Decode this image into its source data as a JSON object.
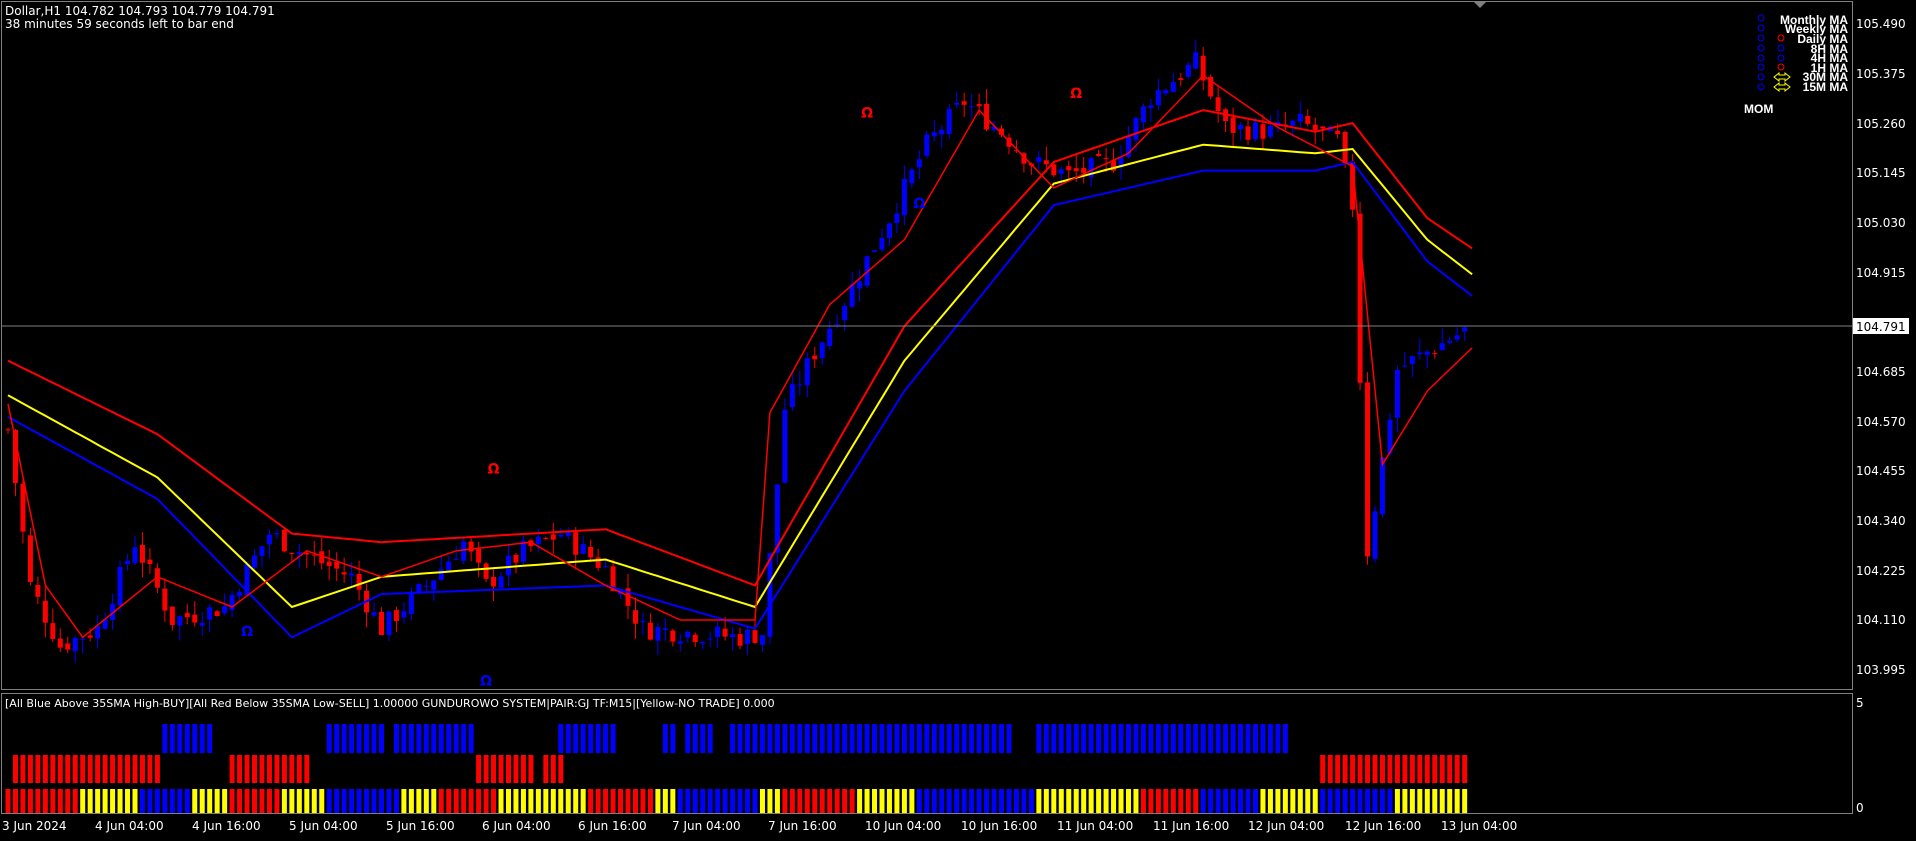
{
  "header": {
    "symbol_line": "Dollar,H1  104.782 104.793 104.779 104.791",
    "timer_line": "38 minutes 59 seconds left to bar end"
  },
  "price_axis": {
    "labels": [
      "105.490",
      "105.375",
      "105.260",
      "105.145",
      "105.030",
      "104.915",
      "104.685",
      "104.570",
      "104.455",
      "104.340",
      "104.225",
      "104.110",
      "103.995"
    ],
    "current_price": "104.791"
  },
  "time_axis": {
    "labels": [
      "3 Jun 2024",
      "4 Jun 04:00",
      "4 Jun 16:00",
      "5 Jun 04:00",
      "5 Jun 16:00",
      "6 Jun 04:00",
      "6 Jun 16:00",
      "7 Jun 04:00",
      "7 Jun 16:00",
      "10 Jun 04:00",
      "10 Jun 16:00",
      "11 Jun 04:00",
      "11 Jun 16:00",
      "12 Jun 04:00",
      "12 Jun 16:00",
      "13 Jun 04:00"
    ]
  },
  "legend": {
    "items": [
      "Monthly MA",
      "Weekly MA",
      "Daily MA",
      "8H MA",
      "4H MA",
      "1H MA",
      "30M MA",
      "15M MA"
    ],
    "mom_label": "MOM"
  },
  "indicator": {
    "title": "[All Blue Above 35SMA High-BUY][All Red Below 35SMA Low-SELL] 1.00000  GUNDUROWO SYSTEM|PAIR:GJ TF:M15|[Yellow-NO TRADE] 0.000",
    "scale_top": "5",
    "scale_bottom": "0"
  },
  "colors": {
    "background": "#000000",
    "bull": "#0000FF",
    "bear": "#FF0000",
    "ma_mid": "#FFFF00",
    "text": "#FFFFFF",
    "price_line": "#808080"
  },
  "chart_data": {
    "type": "candlestick",
    "symbol": "Dollar",
    "timeframe": "H1",
    "ylim": [
      103.95,
      105.56
    ],
    "current_price": 104.791,
    "close_path": [
      [
        0,
        104.56
      ],
      [
        3,
        104.2
      ],
      [
        7,
        104.06
      ],
      [
        12,
        104.1
      ],
      [
        17,
        104.3
      ],
      [
        22,
        104.12
      ],
      [
        29,
        104.15
      ],
      [
        35,
        104.32
      ],
      [
        40,
        104.27
      ],
      [
        46,
        104.22
      ],
      [
        50,
        104.1
      ],
      [
        56,
        104.2
      ],
      [
        61,
        104.3
      ],
      [
        64,
        104.2
      ],
      [
        69,
        104.28
      ],
      [
        74,
        104.32
      ],
      [
        80,
        104.24
      ],
      [
        85,
        104.1
      ],
      [
        92,
        104.09
      ],
      [
        98,
        104.08
      ],
      [
        101,
        104.09
      ],
      [
        104,
        104.61
      ],
      [
        108,
        104.74
      ],
      [
        113,
        104.89
      ],
      [
        118,
        105.05
      ],
      [
        123,
        105.22
      ],
      [
        128,
        105.32
      ],
      [
        133,
        105.25
      ],
      [
        137,
        105.18
      ],
      [
        142,
        105.15
      ],
      [
        148,
        105.18
      ],
      [
        153,
        105.33
      ],
      [
        159,
        105.41
      ],
      [
        163,
        105.26
      ],
      [
        169,
        105.25
      ],
      [
        173,
        105.27
      ],
      [
        178,
        105.23
      ],
      [
        180,
        105.08
      ],
      [
        182,
        104.28
      ],
      [
        186,
        104.7
      ],
      [
        190,
        104.74
      ],
      [
        195,
        104.79
      ]
    ],
    "ma_upper_path": [
      [
        0,
        104.72
      ],
      [
        20,
        104.55
      ],
      [
        38,
        104.32
      ],
      [
        50,
        104.3
      ],
      [
        80,
        104.33
      ],
      [
        100,
        104.2
      ],
      [
        120,
        104.8
      ],
      [
        140,
        105.18
      ],
      [
        160,
        105.3
      ],
      [
        175,
        105.25
      ],
      [
        180,
        105.27
      ],
      [
        190,
        105.05
      ],
      [
        196,
        104.98
      ]
    ],
    "ma_mid_path": [
      [
        0,
        104.64
      ],
      [
        20,
        104.45
      ],
      [
        38,
        104.15
      ],
      [
        50,
        104.22
      ],
      [
        80,
        104.26
      ],
      [
        100,
        104.15
      ],
      [
        120,
        104.72
      ],
      [
        140,
        105.13
      ],
      [
        160,
        105.22
      ],
      [
        175,
        105.2
      ],
      [
        180,
        105.21
      ],
      [
        190,
        105.0
      ],
      [
        196,
        104.92
      ]
    ],
    "ma_lower_path": [
      [
        0,
        104.59
      ],
      [
        20,
        104.4
      ],
      [
        38,
        104.08
      ],
      [
        50,
        104.18
      ],
      [
        80,
        104.2
      ],
      [
        100,
        104.1
      ],
      [
        120,
        104.65
      ],
      [
        140,
        105.08
      ],
      [
        160,
        105.16
      ],
      [
        175,
        105.16
      ],
      [
        180,
        105.18
      ],
      [
        190,
        104.95
      ],
      [
        196,
        104.87
      ]
    ],
    "fast_ma_path": [
      [
        0,
        104.62
      ],
      [
        5,
        104.2
      ],
      [
        10,
        104.08
      ],
      [
        20,
        104.22
      ],
      [
        30,
        104.15
      ],
      [
        40,
        104.28
      ],
      [
        50,
        104.22
      ],
      [
        60,
        104.28
      ],
      [
        70,
        104.3
      ],
      [
        80,
        104.2
      ],
      [
        90,
        104.12
      ],
      [
        100,
        104.12
      ],
      [
        102,
        104.6
      ],
      [
        110,
        104.85
      ],
      [
        120,
        105.0
      ],
      [
        130,
        105.3
      ],
      [
        140,
        105.12
      ],
      [
        150,
        105.2
      ],
      [
        160,
        105.38
      ],
      [
        170,
        105.26
      ],
      [
        180,
        105.17
      ],
      [
        184,
        104.48
      ],
      [
        190,
        104.65
      ],
      [
        196,
        104.75
      ]
    ],
    "momentum_bars": {
      "blue_segments": [
        [
          21,
          27
        ],
        [
          43,
          50
        ],
        [
          52,
          62
        ],
        [
          74,
          81
        ],
        [
          88,
          89
        ],
        [
          91,
          92
        ],
        [
          93,
          94
        ],
        [
          97,
          100
        ],
        [
          101,
          134
        ],
        [
          138,
          171
        ]
      ],
      "red_segments": [
        [
          1,
          20
        ],
        [
          30,
          40
        ],
        [
          63,
          70
        ],
        [
          72,
          74
        ],
        [
          176,
          195
        ]
      ],
      "bottom_row_sequence": "RRRRRRRRRRYYYYYYYYBBBBBBBYYYYYRRRRRRRYYYYYYBBBBBBBBBBYYYYYRRRRRRRRYYYYYYYYYYYYRRRRRRRRRYYYBBBBBBBBBBBYYYRRRRRRRRRRYYYYYYYYBBBBBBBBBBBBBBBBYYYYYYYYYYYYYYRRRRRRRRBBBBBBBBYYYYYYYYBBBBBBBBBBYYYYYYYYYYYYYYRRRRRRRRRRRRRYYYYYYYYYYYYYRRRRRRRRYYYYY"
    }
  }
}
